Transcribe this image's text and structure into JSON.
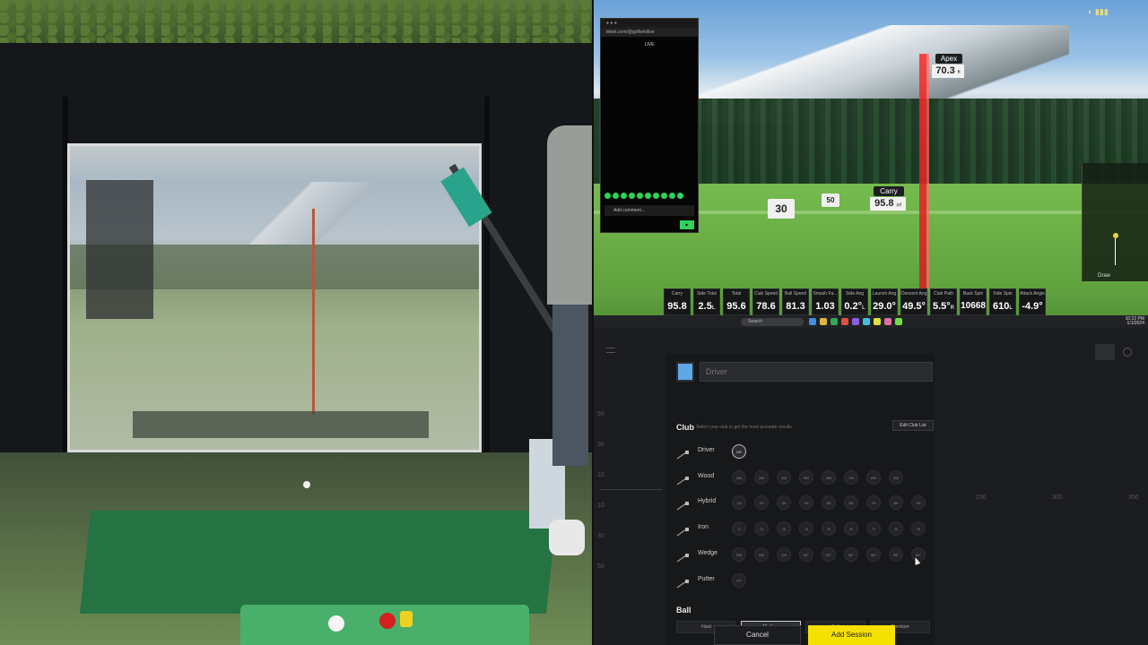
{
  "simulator": {
    "apex_label": "Apex",
    "apex_value": "70.3",
    "apex_unit": "ft",
    "carry_label": "Carry",
    "carry_value": "95.8",
    "carry_unit": "yd",
    "flag_30": "30",
    "flag_50": "50",
    "minimap_label": "Draw",
    "stats": [
      {
        "label": "Carry",
        "value": "95.8",
        "unit": ""
      },
      {
        "label": "Side Total",
        "value": "2.5",
        "unit": "L"
      },
      {
        "label": "Total",
        "value": "95.6",
        "unit": ""
      },
      {
        "label": "Club Speed",
        "value": "78.6",
        "unit": ""
      },
      {
        "label": "Ball Speed",
        "value": "81.3",
        "unit": ""
      },
      {
        "label": "Smash Fa...",
        "value": "1.03",
        "unit": ""
      },
      {
        "label": "Side Ang",
        "value": "0.2°",
        "unit": "L"
      },
      {
        "label": "Launch Ang",
        "value": "29.0°",
        "unit": ""
      },
      {
        "label": "Descent Ang",
        "value": "49.5°",
        "unit": ""
      },
      {
        "label": "Club Path",
        "value": "5.5°",
        "unit": "R"
      },
      {
        "label": "Back Spin",
        "value": "10668",
        "unit": ""
      },
      {
        "label": "Side Spin",
        "value": "610",
        "unit": "L"
      },
      {
        "label": "Attack Angle",
        "value": "-4.9°",
        "unit": ""
      }
    ],
    "browser": {
      "url": "tiktok.com/@golfsim/live",
      "head": "LIVE",
      "comment_placeholder": "Add comment..."
    },
    "taskbar": {
      "search": "Search",
      "time": "10:22 PM",
      "date": "1/1/2024"
    }
  },
  "session": {
    "name_placeholder": "Driver",
    "club_heading": "Club",
    "club_subtitle": "Select your club to get the most accurate results.",
    "edit_club_list": "Edit Club List",
    "clubs": [
      {
        "name": "Driver",
        "options": [
          "DR"
        ],
        "selected": 0
      },
      {
        "name": "Wood",
        "options": [
          "2W",
          "3W",
          "4W",
          "5W",
          "6W",
          "7W",
          "8W",
          "9W"
        ],
        "selected": -1
      },
      {
        "name": "Hybrid",
        "options": [
          "1H",
          "2H",
          "3H",
          "4H",
          "5H",
          "6H",
          "7H",
          "8H",
          "9H"
        ],
        "selected": -1
      },
      {
        "name": "Iron",
        "options": [
          "1i",
          "2i",
          "3i",
          "4i",
          "5i",
          "6i",
          "7i",
          "8i",
          "9i"
        ],
        "selected": -1
      },
      {
        "name": "Wedge",
        "options": [
          "PW",
          "SW",
          "LW",
          "50°",
          "52°",
          "54°",
          "56°",
          "58°",
          "60°"
        ],
        "selected": -1
      },
      {
        "name": "Putter",
        "options": [
          "PT"
        ],
        "selected": -1
      }
    ],
    "ball_heading": "Ball",
    "ball_options": [
      "Hard",
      "Medium",
      "Soft",
      "Premium"
    ],
    "ball_selected": 1,
    "cancel_label": "Cancel",
    "add_label": "Add Session",
    "bg_axis_y": [
      "50",
      "30",
      "10",
      "10",
      "30",
      "50"
    ],
    "bg_axis_x": [
      "250",
      "300",
      "350"
    ]
  },
  "colors": {
    "accent": "#f5e100",
    "swatch": "#5fa8e8",
    "shot_line": "#ff2a2a"
  }
}
